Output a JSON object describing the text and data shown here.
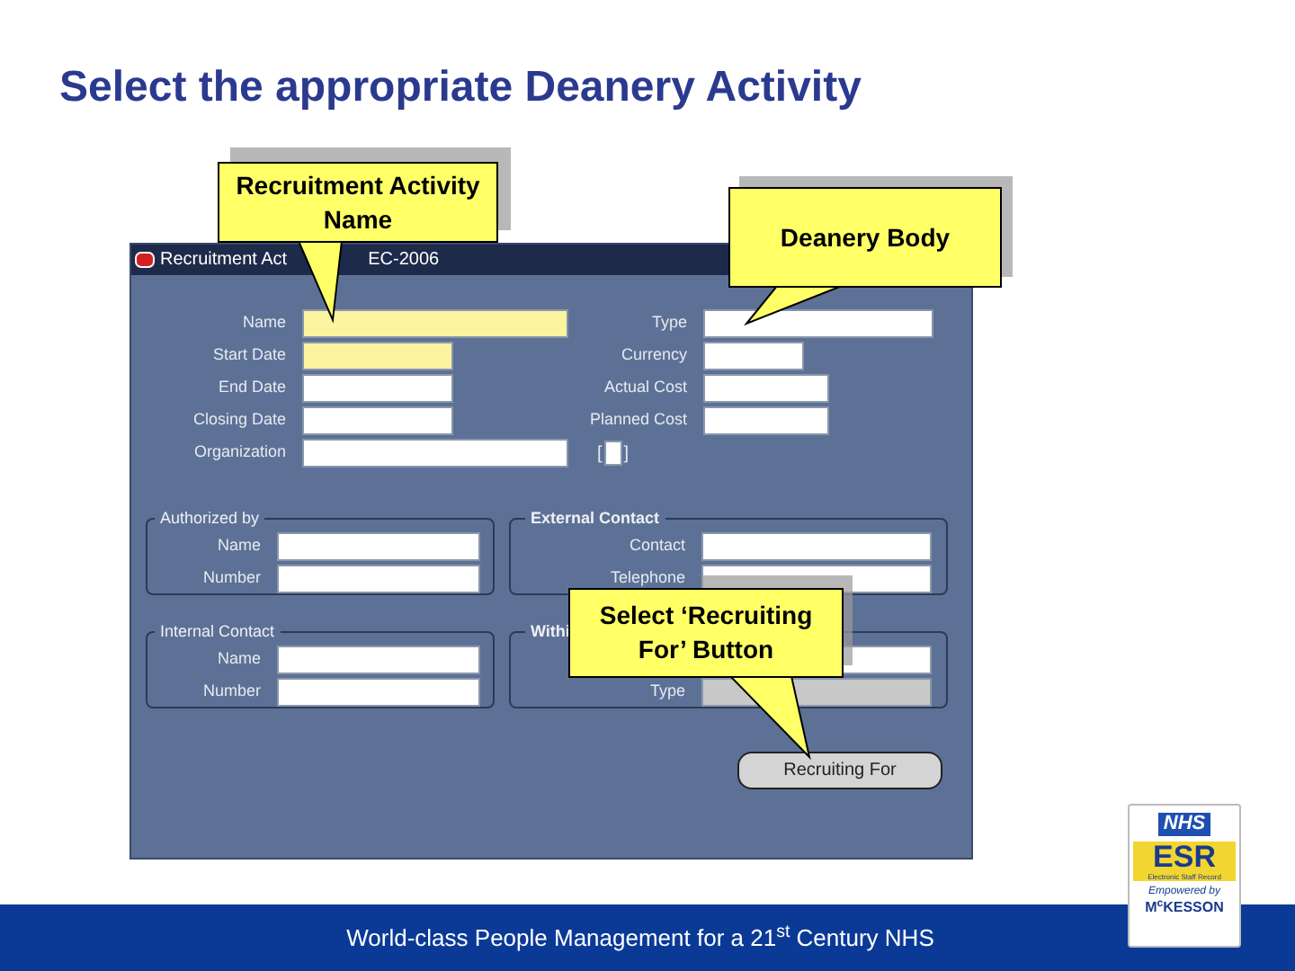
{
  "slide": {
    "title": "Select the appropriate Deanery Activity"
  },
  "window": {
    "title_start": "Recruitment Act",
    "title_end": "EC-2006",
    "top_rows": [
      {
        "left": {
          "label": "Name",
          "required": true
        },
        "right": {
          "kind": "text",
          "label": "Type",
          "required": false
        }
      },
      {
        "left": {
          "label": "Start Date",
          "required": true
        },
        "right": {
          "kind": "text",
          "label": "Currency",
          "required": false
        }
      },
      {
        "left": {
          "label": "End Date",
          "required": false
        },
        "right": {
          "kind": "text",
          "label": "Actual Cost",
          "required": false
        }
      },
      {
        "left": {
          "label": "Closing Date",
          "required": false
        },
        "right": {
          "kind": "text",
          "label": "Planned Cost",
          "required": false
        }
      },
      {
        "left": {
          "label": "Organization",
          "required": false
        },
        "right": {
          "kind": "checkbox",
          "open": "[",
          "close": "]",
          "checked": false
        }
      }
    ],
    "groups": [
      {
        "legend": "Authorized by",
        "fields": [
          {
            "label": "Name",
            "disabled": false
          },
          {
            "label": "Number",
            "disabled": false
          }
        ]
      },
      {
        "legend": "External Contact",
        "fields": [
          {
            "label": "Contact",
            "disabled": false
          },
          {
            "label": "Telephone",
            "disabled": false
          }
        ]
      },
      {
        "legend": "Internal Contact",
        "fields": [
          {
            "label": "Name",
            "disabled": false
          },
          {
            "label": "Number",
            "disabled": false
          }
        ]
      },
      {
        "legend": "Withi",
        "fields": [
          {
            "disabled": false
          },
          {
            "label": "Type",
            "disabled": true
          }
        ]
      }
    ],
    "button": "Recruiting For"
  },
  "callouts": [
    {
      "text": "Recruitment Activity Name"
    },
    {
      "text": "Deanery Body"
    },
    {
      "text": "Select ‘Recruiting For’ Button"
    }
  ],
  "footer": {
    "text": "World-class People Management for a 21$^{st}$ Century NHS"
  },
  "logo": {
    "nhs": "NHS",
    "esr": "ESR",
    "esr_sub": "Electronic Staff Record",
    "empowered": "Empowered by",
    "company": "M$^{c}$KESSON"
  }
}
